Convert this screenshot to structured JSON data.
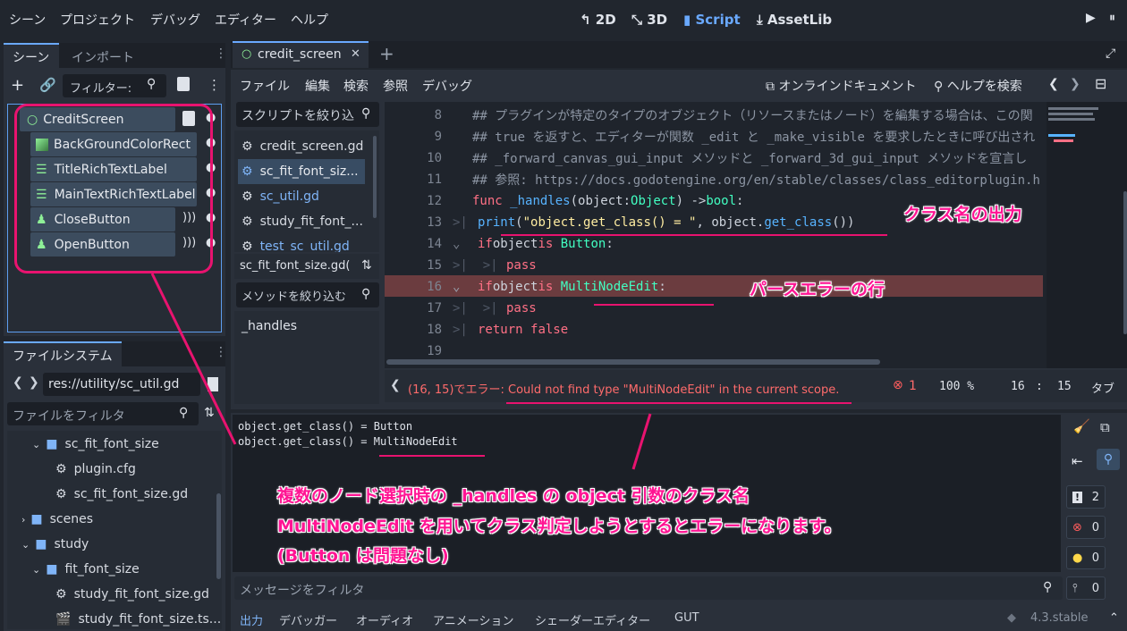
{
  "menu": [
    "シーン",
    "プロジェクト",
    "デバッグ",
    "エディター",
    "ヘルプ"
  ],
  "workspaces": {
    "w2d": "2D",
    "w3d": "3D",
    "script": "Script",
    "assetlib": "AssetLib"
  },
  "scene_dock": {
    "tab_scene": "シーン",
    "tab_import": "インポート",
    "filter": "フィルター:",
    "nodes": [
      "CreditScreen",
      "BackGroundColorRect",
      "TitleRichTextLabel",
      "MainTextRichTextLabel",
      "CloseButton",
      "OpenButton"
    ]
  },
  "filesystem": {
    "tab": "ファイルシステム",
    "path": "res://utility/sc_util.gd",
    "filter": "ファイルをフィルタ",
    "items": [
      "sc_fit_font_size",
      "plugin.cfg",
      "sc_fit_font_size.gd",
      "scenes",
      "study",
      "fit_font_size",
      "study_fit_font_size.gd",
      "study_fit_font_size.ts..."
    ]
  },
  "script_tab": "credit_screen",
  "script_menu": [
    "ファイル",
    "編集",
    "検索",
    "参照",
    "デバッグ"
  ],
  "online_doc": "オンラインドキュメント",
  "help_search": "ヘルプを検索",
  "script_filter": "スクリプトを絞り込",
  "scripts": [
    "credit_screen.gd",
    "sc_fit_font_siz...",
    "sc_util.gd",
    "study_fit_font_...",
    "test_sc_util.gd"
  ],
  "current_script": "sc_fit_font_size.gd(",
  "method_filter": "メソッドを絞り込む",
  "methods": [
    "_handles"
  ],
  "code": {
    "l8": "## プラグインが特定のタイプのオブジェクト（リソースまたはノード）を編集する場合は、この関",
    "l9": "## true を返すと、エディターが関数 _edit と _make_visible を要求したときに呼び出され",
    "l10": "##  _forward_canvas_gui_input メソッドと _forward_3d_gui_input メソッドを宣言し",
    "l11": "## 参照: https://docs.godotengine.org/en/stable/classes/class_editorplugin.h",
    "l12a": "func",
    "l12b": "_handles",
    "l12c": "(object: ",
    "l12d": "Object",
    "l12e": ") -> ",
    "l12f": "bool",
    ":": ":",
    "l13a": "print",
    "l13b": "\"object.get_class() = \"",
    "l13c": ", object.",
    "l13d": "get_class",
    "l13e": "())",
    "l14a": "if",
    "l14b": " object ",
    "l14c": "is",
    "l14d": "Button",
    "l15": "pass",
    "l16a": "if",
    "l16b": " object ",
    "l16c": "is",
    "l16d": "MultiNodeEdit",
    "l17": "pass",
    "l18a": "return",
    "l18b": "false"
  },
  "line_numbers": [
    "8",
    "9",
    "10",
    "11",
    "12",
    "13",
    "14",
    "15",
    "16",
    "17",
    "18",
    "19"
  ],
  "status": {
    "error": "(16, 15)でエラー: Could not find type \"MultiNodeEdit\" in the current scope.",
    "err_count": "1",
    "zoom": "100 %",
    "line": "16",
    "sep": ":",
    "col": "15",
    "tab": "タブ"
  },
  "output": {
    "lines": [
      "object.get_class() = Button",
      "object.get_class() = MultiNodeEdit"
    ],
    "filter": "メッセージをフィルタ",
    "counts": [
      "2",
      "0",
      "0",
      "0"
    ]
  },
  "bottom_tabs": [
    "出力",
    "デバッガー",
    "オーディオ",
    "アニメーション",
    "シェーダーエディター",
    "GUT"
  ],
  "version": "4.3.stable",
  "annotations": {
    "a1": "クラス名の出力",
    "a2": "パースエラーの行",
    "a3_1": "複数のノード選択時の _handles の object 引数のクラス名",
    "a3_2": "MultiNodeEdit を用いてクラス判定しようとするとエラーになります。",
    "a3_3": "(Button は問題なし)"
  }
}
